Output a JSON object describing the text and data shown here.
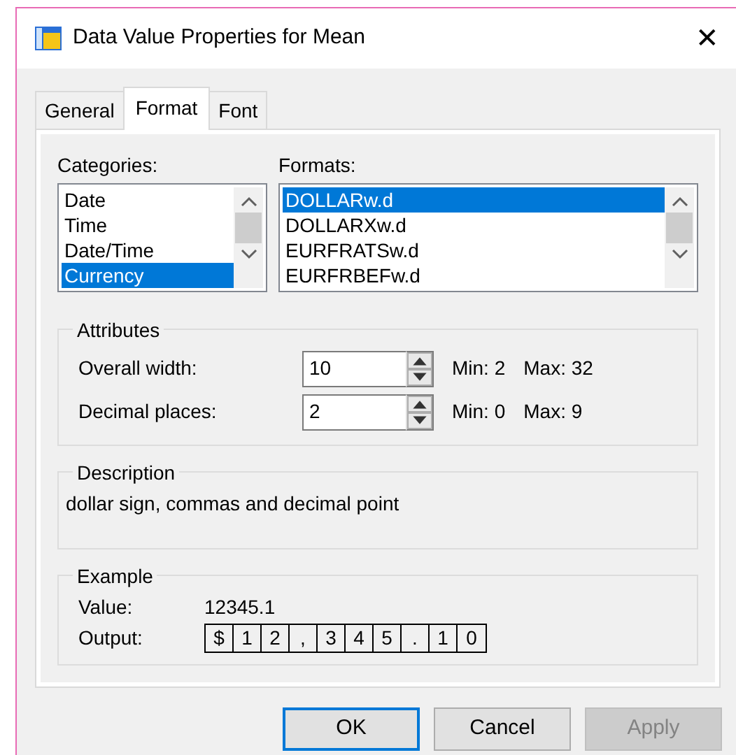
{
  "window": {
    "title": "Data Value Properties for Mean",
    "close": "✕"
  },
  "tabs": [
    {
      "label": "General",
      "selected": false
    },
    {
      "label": "Format",
      "selected": true
    },
    {
      "label": "Font",
      "selected": false
    }
  ],
  "categories": {
    "label": "Categories:",
    "items": [
      {
        "label": "Date",
        "selected": false
      },
      {
        "label": "Time",
        "selected": false
      },
      {
        "label": "Date/Time",
        "selected": false
      },
      {
        "label": "Currency",
        "selected": true
      }
    ]
  },
  "formats": {
    "label": "Formats:",
    "items": [
      {
        "label": "DOLLARw.d",
        "selected": true
      },
      {
        "label": "DOLLARXw.d",
        "selected": false
      },
      {
        "label": "EURFRATSw.d",
        "selected": false
      },
      {
        "label": "EURFRBEFw.d",
        "selected": false
      }
    ]
  },
  "attributes": {
    "title": "Attributes",
    "fields": [
      {
        "label": "Overall width:",
        "value": "10",
        "min": "Min: 2",
        "max": "Max: 32"
      },
      {
        "label": "Decimal places:",
        "value": "2",
        "min": "Min: 0",
        "max": "Max: 9"
      }
    ]
  },
  "description": {
    "title": "Description",
    "text": "dollar sign, commas and decimal point"
  },
  "example": {
    "title": "Example",
    "value_label": "Value:",
    "value": "12345.1",
    "output_label": "Output:",
    "output": [
      "$",
      "1",
      "2",
      ",",
      "3",
      "4",
      "5",
      ".",
      "1",
      "0"
    ]
  },
  "buttons": [
    {
      "label": "OK",
      "default": true,
      "disabled": false
    },
    {
      "label": "Cancel",
      "default": false,
      "disabled": false
    },
    {
      "label": "Apply",
      "default": false,
      "disabled": true
    }
  ]
}
